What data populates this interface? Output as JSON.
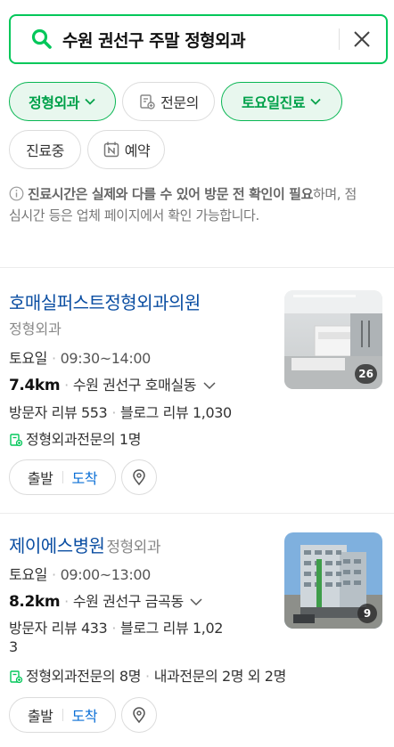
{
  "search": {
    "query": "수원 권선구 주말 정형외과"
  },
  "filters": {
    "row1": [
      {
        "label": "정형외과",
        "active": true,
        "dropdown": true,
        "icon": ""
      },
      {
        "label": "전문의",
        "active": false,
        "dropdown": false,
        "icon": "doctor-badge-icon"
      },
      {
        "label": "토요일진료",
        "active": true,
        "dropdown": true,
        "icon": ""
      }
    ],
    "row2": [
      {
        "label": "진료중",
        "active": false,
        "icon": ""
      },
      {
        "label": "예약",
        "active": false,
        "icon": "naver-booking-icon"
      }
    ]
  },
  "notice": {
    "bold": "진료시간은 실제와 다를 수 있어 방문 전 확인이 필요",
    "rest": "하며, 점심시간 등은 업체 페이지에서 확인 가능합니다."
  },
  "results": [
    {
      "name": "호매실퍼스트정형외과의원",
      "category": "정형외과",
      "day": "토요일",
      "hours": "09:30~14:00",
      "distance": "7.4km",
      "address": "수원 권선구 호매실동",
      "visitor_reviews": "방문자 리뷰 553",
      "blog_reviews": "블로그 리뷰 1,030",
      "specialists": "정형외과전문의 1명",
      "photo_count": "26",
      "depart_label": "출발",
      "arrive_label": "도착"
    },
    {
      "name": "제이에스병원",
      "category": "정형외과",
      "day": "토요일",
      "hours": "09:00~13:00",
      "distance": "8.2km",
      "address": "수원 권선구 금곡동",
      "visitor_reviews": "방문자 리뷰 433",
      "blog_reviews_line1": "블로그 리뷰 1,02",
      "blog_reviews_line2": "3",
      "specialists": "정형외과전문의 8명",
      "specialists_extra": "내과전문의 2명 외 2명",
      "photo_count": "9",
      "depart_label": "출발",
      "arrive_label": "도착"
    }
  ],
  "colors": {
    "accent": "#03c75a",
    "link": "#0b4ea2",
    "arrive": "#0b6fd6"
  }
}
